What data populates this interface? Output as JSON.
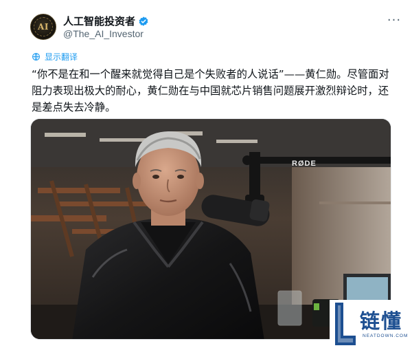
{
  "author": {
    "display_name": "人工智能投资者",
    "handle": "@The_AI_Investor",
    "avatar_icon": "ai-investor-logo",
    "avatar_monogram": "AI",
    "verified": true,
    "verified_color": "#1d9bf0"
  },
  "post": {
    "translate_label": "显示翻译",
    "translate_icon": "globe-icon",
    "text": "“你不是在和一个醒来就觉得自己是个失败者的人说话”——黄仁勋。尽管面对阻力表现出极大的耐心，黄仁勋在与中国就芯片销售问题展开激烈辩论时，还是差点失去冷静。",
    "more_icon": "more-icon"
  },
  "media": {
    "mic_brand": "RØDE"
  },
  "watermark": {
    "text": "链懂",
    "sub": "NEATDOWN.COM",
    "color": "#1d4f91"
  },
  "colors": {
    "link": "#1d9bf0",
    "secondary_text": "#536471",
    "primary_text": "#0f1419"
  }
}
